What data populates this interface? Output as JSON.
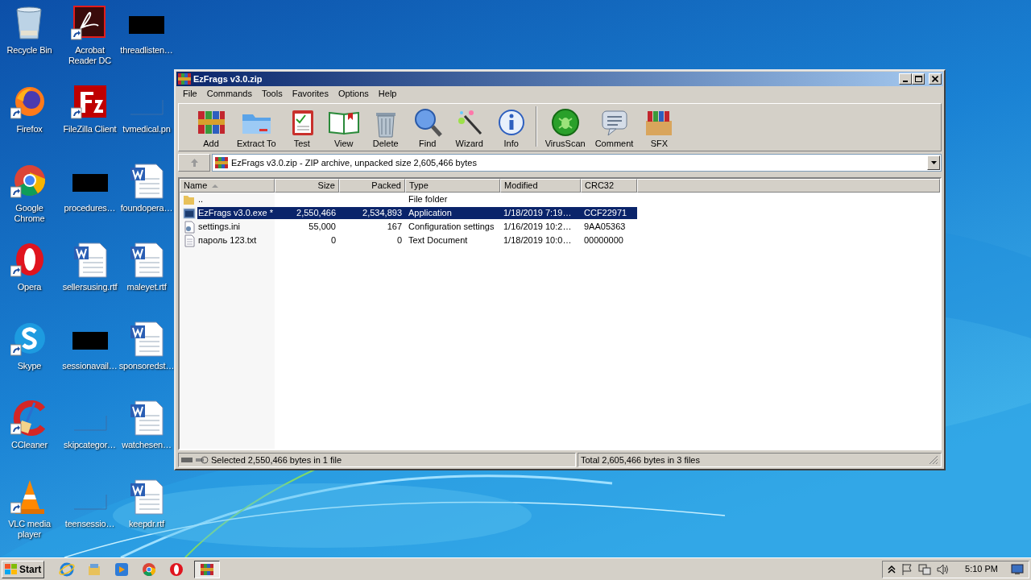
{
  "desktop": {
    "icons": [
      {
        "label": "Recycle Bin",
        "kind": "recycle",
        "shortcut": false
      },
      {
        "label": "Acrobat Reader DC",
        "kind": "acrobat",
        "shortcut": true
      },
      {
        "label": "threadlisten…",
        "kind": "redacted",
        "shortcut": false
      },
      {
        "label": "Firefox",
        "kind": "firefox",
        "shortcut": true
      },
      {
        "label": "FileZilla Client",
        "kind": "filezilla",
        "shortcut": true
      },
      {
        "label": "tvmedical.pn",
        "kind": "blank",
        "shortcut": false
      },
      {
        "label": "Google Chrome",
        "kind": "chrome",
        "shortcut": true
      },
      {
        "label": "procedures…",
        "kind": "redacted",
        "shortcut": false
      },
      {
        "label": "foundopera…",
        "kind": "word",
        "shortcut": false
      },
      {
        "label": "Opera",
        "kind": "opera",
        "shortcut": true
      },
      {
        "label": "sellersusing.rtf",
        "kind": "word",
        "shortcut": false
      },
      {
        "label": "maleyet.rtf",
        "kind": "word",
        "shortcut": false
      },
      {
        "label": "Skype",
        "kind": "skype",
        "shortcut": true
      },
      {
        "label": "sessionavail…",
        "kind": "redacted",
        "shortcut": false
      },
      {
        "label": "sponsoredst…",
        "kind": "word",
        "shortcut": false
      },
      {
        "label": "CCleaner",
        "kind": "ccleaner",
        "shortcut": true
      },
      {
        "label": "skipcategor…",
        "kind": "blank",
        "shortcut": false
      },
      {
        "label": "watchesen…",
        "kind": "word",
        "shortcut": false
      },
      {
        "label": "VLC media player",
        "kind": "vlc",
        "shortcut": true
      },
      {
        "label": "teensessio…",
        "kind": "blank",
        "shortcut": false
      },
      {
        "label": "keepdr.rtf",
        "kind": "word",
        "shortcut": false
      }
    ]
  },
  "window": {
    "title": "EzFrags v3.0.zip",
    "menu": [
      "File",
      "Commands",
      "Tools",
      "Favorites",
      "Options",
      "Help"
    ],
    "toolbar": [
      {
        "label": "Add",
        "kind": "add"
      },
      {
        "label": "Extract To",
        "kind": "extract"
      },
      {
        "label": "Test",
        "kind": "test"
      },
      {
        "label": "View",
        "kind": "view"
      },
      {
        "label": "Delete",
        "kind": "delete"
      },
      {
        "label": "Find",
        "kind": "find"
      },
      {
        "label": "Wizard",
        "kind": "wizard"
      },
      {
        "label": "Info",
        "kind": "info"
      },
      {
        "label": "VirusScan",
        "kind": "virus"
      },
      {
        "label": "Comment",
        "kind": "comment"
      },
      {
        "label": "SFX",
        "kind": "sfx"
      }
    ],
    "address": "EzFrags v3.0.zip - ZIP archive, unpacked size 2,605,466 bytes",
    "columns": [
      {
        "label": "Name",
        "sorted": true
      },
      {
        "label": "Size",
        "sorted": false
      },
      {
        "label": "Packed",
        "sorted": false
      },
      {
        "label": "Type",
        "sorted": false
      },
      {
        "label": "Modified",
        "sorted": false
      },
      {
        "label": "CRC32",
        "sorted": false
      }
    ],
    "rows": [
      {
        "kind": "folder",
        "name": "..",
        "type": "File folder",
        "selected": false
      },
      {
        "kind": "exe",
        "name": "EzFrags v3.0.exe *",
        "size": "2,550,466",
        "packed": "2,534,893",
        "type": "Application",
        "modified": "1/18/2019 7:19…",
        "crc": "CCF22971",
        "selected": true
      },
      {
        "kind": "ini",
        "name": "settings.ini",
        "size": "55,000",
        "packed": "167",
        "type": "Configuration settings",
        "modified": "1/16/2019 10:2…",
        "crc": "9AA05363",
        "selected": false
      },
      {
        "kind": "txt",
        "name": "пароль 123.txt",
        "size": "0",
        "packed": "0",
        "type": "Text Document",
        "modified": "1/18/2019 10:0…",
        "crc": "00000000",
        "selected": false
      }
    ],
    "status_left": "Selected 2,550,466 bytes in 1 file",
    "status_right": "Total 2,605,466 bytes in 3 files"
  },
  "taskbar": {
    "start": "Start",
    "items": [
      {
        "kind": "ie",
        "active": false
      },
      {
        "kind": "explorer",
        "active": false
      },
      {
        "kind": "media",
        "active": false
      },
      {
        "kind": "chrome",
        "active": false
      },
      {
        "kind": "opera",
        "active": false
      },
      {
        "kind": "winrar",
        "active": true
      }
    ],
    "clock": "5:10 PM"
  }
}
